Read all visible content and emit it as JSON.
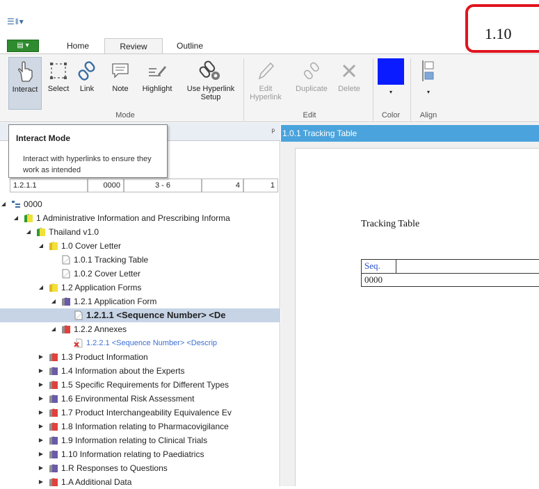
{
  "quick_access": {
    "icon": "document-list-icon",
    "glyph": "☰‖▾"
  },
  "step_badge": {
    "label": "1.10"
  },
  "tabs": {
    "app_menu_glyph": "▤ ▾",
    "items": [
      {
        "label": "Home"
      },
      {
        "label": "Review"
      },
      {
        "label": "Outline"
      }
    ],
    "active": "Review"
  },
  "ribbon": {
    "buttons": [
      {
        "label": "Interact",
        "icon": "hand-pointer-icon"
      },
      {
        "label": "Select",
        "icon": "select-box-icon"
      },
      {
        "label": "Link",
        "icon": "chain-link-icon"
      },
      {
        "label": "Note",
        "icon": "note-icon"
      },
      {
        "label": "Highlight",
        "icon": "highlighter-icon"
      },
      {
        "label": "Use Hyperlink",
        "label2": "Setup",
        "icon": "link-settings-icon"
      },
      {
        "label": "Edit",
        "label2": "Hyperlink",
        "icon": "pencil-icon"
      },
      {
        "label": "Duplicate",
        "icon": "duplicate-link-icon"
      },
      {
        "label": "Delete",
        "icon": "delete-x-icon"
      },
      {
        "label": "Color",
        "icon": "color-swatch-icon"
      },
      {
        "label": "Align",
        "icon": "align-icon"
      }
    ],
    "groups": [
      {
        "label": "Mode"
      },
      {
        "label": "Edit"
      },
      {
        "label": "Color"
      },
      {
        "label": "Align"
      }
    ],
    "swatch_color": "#0a1cff",
    "active_color": "#cfd8e3"
  },
  "tooltip": {
    "title": "Interact Mode",
    "body": "Interact with hyperlinks to ensure they work as intended"
  },
  "filter_row": [
    "1.2.1.1",
    "0000",
    "3 - 6",
    "4",
    "1"
  ],
  "tree": [
    {
      "label": "0000",
      "depth": 0,
      "tw": "◢",
      "icon": "root"
    },
    {
      "label": "1 Administrative Information and Prescribing Informa",
      "depth": 1,
      "tw": "◢",
      "icon": "folder-yg"
    },
    {
      "label": "Thailand v1.0",
      "depth": 2,
      "tw": "◢",
      "icon": "folder-yg"
    },
    {
      "label": "1.0 Cover Letter",
      "depth": 3,
      "tw": "◢",
      "icon": "folder-y"
    },
    {
      "label": "1.0.1 Tracking Table",
      "depth": 4,
      "tw": "",
      "icon": "doc-white"
    },
    {
      "label": "1.0.2 Cover Letter",
      "depth": 4,
      "tw": "",
      "icon": "doc-white"
    },
    {
      "label": "1.2 Application Forms",
      "depth": 3,
      "tw": "◢",
      "icon": "folder-y"
    },
    {
      "label": "1.2.1 Application Form",
      "depth": 4,
      "tw": "◢",
      "icon": "folder-purple"
    },
    {
      "label": "1.2.1.1 <Sequence Number> <De",
      "depth": 5,
      "tw": "",
      "icon": "doc-white",
      "selected": true
    },
    {
      "label": "1.2.2 Annexes",
      "depth": 4,
      "tw": "◢",
      "icon": "folder-red"
    },
    {
      "label": "1.2.2.1 <Sequence Number> <Descrip",
      "depth": 5,
      "tw": "",
      "icon": "doc-x",
      "link": true
    },
    {
      "label": "1.3 Product Information",
      "depth": 3,
      "tw": "▶",
      "icon": "folder-red"
    },
    {
      "label": "1.4 Information about the Experts",
      "depth": 3,
      "tw": "▶",
      "icon": "folder-purple"
    },
    {
      "label": "1.5 Specific Requirements for Different Types",
      "depth": 3,
      "tw": "▶",
      "icon": "folder-red"
    },
    {
      "label": "1.6 Environmental Risk Assessment",
      "depth": 3,
      "tw": "▶",
      "icon": "folder-purple"
    },
    {
      "label": "1.7 Product Interchangeability Equivalence Ev",
      "depth": 3,
      "tw": "▶",
      "icon": "folder-red"
    },
    {
      "label": "1.8 Information relating to Pharmacovigilance",
      "depth": 3,
      "tw": "▶",
      "icon": "folder-red"
    },
    {
      "label": "1.9 Information relating to Clinical Trials",
      "depth": 3,
      "tw": "▶",
      "icon": "folder-purple"
    },
    {
      "label": "1.10 Information relating to Paediatrics",
      "depth": 3,
      "tw": "▶",
      "icon": "folder-purple"
    },
    {
      "label": "1.R Responses to Questions",
      "depth": 3,
      "tw": "▶",
      "icon": "folder-purple"
    },
    {
      "label": "1.A Additional Data",
      "depth": 3,
      "tw": "▶",
      "icon": "folder-red"
    }
  ],
  "right_panel": {
    "header": "1.0.1 Tracking Table",
    "doc_title": "Tracking Table",
    "table_header": "Seq.",
    "table_value": "0000",
    "header_color": "#4aa3dc"
  }
}
